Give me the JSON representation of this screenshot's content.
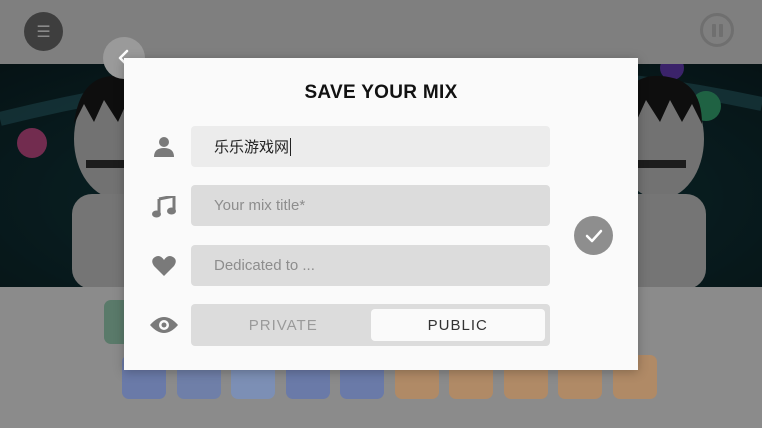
{
  "menu": {
    "icon": "hamburger-icon",
    "glyph": "☰"
  },
  "playback": {
    "icon": "pause-icon"
  },
  "dialog": {
    "title": "SAVE YOUR MIX",
    "author": {
      "icon": "person-icon",
      "value": "乐乐游戏网"
    },
    "mix_title": {
      "icon": "music-note-icon",
      "placeholder": "Your mix title*"
    },
    "dedication": {
      "icon": "heart-icon",
      "placeholder": "Dedicated to ..."
    },
    "visibility": {
      "icon": "eye-icon",
      "options": [
        "PRIVATE",
        "PUBLIC"
      ],
      "selected": "PUBLIC"
    },
    "confirm": {
      "icon": "checkmark-icon"
    },
    "back": {
      "icon": "chevron-left-icon"
    }
  },
  "colors": {
    "overlay_gray": "#8a8a8a",
    "modal_bg": "#fafafa",
    "field_bg": "#dcdcdc",
    "icon_gray": "#7a7a7a",
    "stage_teal": "#1f4f56"
  },
  "sound_icons": [
    {
      "icon": "blue-hat-icon",
      "color": "#6a7aa8"
    },
    {
      "icon": "striped-scarf-icon",
      "color": "#6f7fa8"
    },
    {
      "icon": "dots-icon",
      "color": "#7c8fb5"
    },
    {
      "icon": "shoe-icon",
      "color": "#6a7aa8"
    },
    {
      "icon": "glasses-icon",
      "color": "#6a7aa8"
    },
    {
      "icon": "orange-hat-icon",
      "color": "#b08a66"
    },
    {
      "icon": "hair-icon",
      "color": "#b08a66"
    },
    {
      "icon": "tie-icon",
      "color": "#b08a66"
    },
    {
      "icon": "visor-icon",
      "color": "#b08a66"
    },
    {
      "icon": "headphones-icon",
      "color": "#b08a66"
    }
  ]
}
